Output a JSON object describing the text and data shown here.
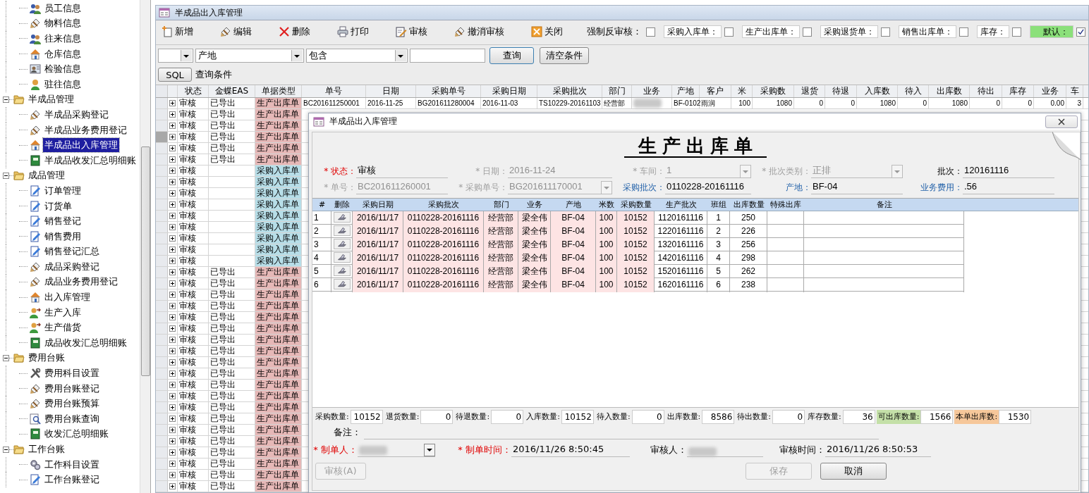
{
  "sidebar": {
    "tree": [
      {
        "children": [
          {
            "label": "员工信息",
            "kind": "people",
            "selected": false
          },
          {
            "label": "物料信息",
            "kind": "pen",
            "selected": false
          },
          {
            "label": "往来信息",
            "kind": "people",
            "selected": false
          },
          {
            "label": "仓库信息",
            "kind": "house",
            "selected": false
          },
          {
            "label": "检验信息",
            "kind": "card",
            "selected": false
          },
          {
            "label": "驻往信息",
            "kind": "person",
            "selected": false
          }
        ]
      },
      {
        "label": "半成品管理",
        "expanded": true,
        "children": [
          {
            "label": "半成品采购登记",
            "kind": "pen",
            "selected": false
          },
          {
            "label": "半成品业务费用登记",
            "kind": "pen",
            "selected": false
          },
          {
            "label": "半成品出入库管理",
            "kind": "house",
            "selected": true
          },
          {
            "label": "半成品收发汇总明细账",
            "kind": "book",
            "selected": false
          }
        ]
      },
      {
        "label": "成品管理",
        "expanded": true,
        "children": [
          {
            "label": "订单管理",
            "kind": "doc",
            "selected": false
          },
          {
            "label": "订货单",
            "kind": "doc",
            "selected": false
          },
          {
            "label": "销售登记",
            "kind": "doc",
            "selected": false
          },
          {
            "label": "销售费用",
            "kind": "doc",
            "selected": false
          },
          {
            "label": "销售登记汇总",
            "kind": "doc",
            "selected": false
          },
          {
            "label": "成品采购登记",
            "kind": "pen",
            "selected": false
          },
          {
            "label": "成品业务费用登记",
            "kind": "pen",
            "selected": false
          },
          {
            "label": "出入库管理",
            "kind": "house",
            "selected": false
          },
          {
            "label": "生产入库",
            "kind": "personarrow",
            "selected": false
          },
          {
            "label": "生产借货",
            "kind": "personarrow",
            "selected": false
          },
          {
            "label": "成品收发汇总明细账",
            "kind": "book",
            "selected": false
          }
        ]
      },
      {
        "label": "费用台账",
        "expanded": true,
        "children": [
          {
            "label": "费用科目设置",
            "kind": "tools",
            "selected": false
          },
          {
            "label": "费用台账登记",
            "kind": "pen",
            "selected": false
          },
          {
            "label": "费用台账预算",
            "kind": "pen",
            "selected": false
          },
          {
            "label": "费用台账查询",
            "kind": "searchdoc",
            "selected": false
          },
          {
            "label": "收发汇总明细账",
            "kind": "book",
            "selected": false
          }
        ]
      },
      {
        "label": "工作台账",
        "expanded": true,
        "children": [
          {
            "label": "工作科目设置",
            "kind": "gears",
            "selected": false
          },
          {
            "label": "工作台账登记",
            "kind": "doc",
            "selected": false
          }
        ]
      }
    ]
  },
  "window": {
    "title": "半成品出入库管理"
  },
  "toolbar": {
    "buttons": [
      {
        "label": "新增",
        "kind": "new"
      },
      {
        "label": "编辑",
        "kind": "pen"
      },
      {
        "label": "删除",
        "kind": "delete"
      },
      {
        "label": "打印",
        "kind": "print"
      },
      {
        "label": "审核",
        "kind": "approve"
      },
      {
        "label": "撤消审核",
        "kind": "pen"
      },
      {
        "label": "关闭",
        "kind": "close"
      }
    ],
    "force_unapprove": {
      "label": "强制反审核：",
      "checked": false
    },
    "filters": [
      {
        "label": "采购入库单：",
        "checked": false,
        "highlighted": false
      },
      {
        "label": "生产出库单：",
        "checked": false,
        "highlighted": false
      },
      {
        "label": "采购退货单：",
        "checked": false,
        "highlighted": false
      },
      {
        "label": "销售出库单：",
        "checked": false,
        "highlighted": false
      },
      {
        "label": "库存：",
        "checked": false,
        "highlighted": false
      },
      {
        "label": "默认：",
        "checked": true,
        "highlighted": true
      }
    ]
  },
  "query": {
    "field": "产地",
    "operator": "包含",
    "search_button": "查询",
    "clear_button": "清空条件",
    "sql_button": "SQL",
    "condition_label": "查询条件"
  },
  "grid": {
    "columns": [
      "状态",
      "金蝶EAS",
      "单据类型",
      "单号",
      "日期",
      "采购单号",
      "采购日期",
      "采购批次",
      "部门",
      "业务",
      "产地",
      "客户",
      "米",
      "采购数",
      "退货",
      "待退",
      "入库数",
      "待入",
      "出库数",
      "待出",
      "库存",
      "业务",
      "车"
    ],
    "rows": [
      {
        "selected": false,
        "color": "#e6b8b7",
        "cells": [
          "审核",
          "已导出",
          "生产出库单",
          "BC201611250001",
          "2016-11-25",
          "BG201611280004",
          "2016-11-03",
          "TS10229-20161103",
          "经营部",
          {
            "redacted": true
          },
          "BF-0102",
          "雨润",
          "100",
          "1080",
          "0",
          "0",
          "1080",
          "0",
          "1080",
          "0",
          "0",
          "0.00",
          "3"
        ]
      },
      {
        "selected": false,
        "color": "#e6b8b7",
        "cells": [
          "审核",
          "已导出",
          "生产出库单"
        ]
      },
      {
        "selected": false,
        "color": "#e6b8b7",
        "cells": [
          "审核",
          "已导出",
          "生产出库单"
        ]
      },
      {
        "selected": true,
        "color": "#e6b8b7",
        "cells": [
          "审核",
          "已导出",
          "生产出库单"
        ]
      },
      {
        "selected": false,
        "color": "#e6b8b7",
        "cells": [
          "审核",
          "已导出",
          "生产出库单"
        ]
      },
      {
        "selected": false,
        "color": "#e6b8b7",
        "cells": [
          "审核",
          "已导出",
          "生产出库单"
        ]
      },
      {
        "selected": false,
        "color": "#b7dee8",
        "cells": [
          "审核",
          null,
          "采购入库单"
        ]
      },
      {
        "selected": false,
        "color": "#b7dee8",
        "cells": [
          "审核",
          null,
          "采购入库单"
        ]
      },
      {
        "selected": false,
        "color": "#b7dee8",
        "cells": [
          "审核",
          null,
          "采购入库单"
        ]
      },
      {
        "selected": false,
        "color": "#b7dee8",
        "cells": [
          "审核",
          null,
          "采购入库单"
        ]
      },
      {
        "selected": false,
        "color": "#b7dee8",
        "cells": [
          "审核",
          null,
          "采购入库单"
        ]
      },
      {
        "selected": false,
        "color": "#b7dee8",
        "cells": [
          "审核",
          null,
          "采购入库单"
        ]
      },
      {
        "selected": false,
        "color": "#b7dee8",
        "cells": [
          "审核",
          null,
          "采购入库单"
        ]
      },
      {
        "selected": false,
        "color": "#b7dee8",
        "cells": [
          "审核",
          null,
          "采购入库单"
        ]
      },
      {
        "selected": false,
        "color": "#b7dee8",
        "cells": [
          "审核",
          null,
          "采购入库单"
        ]
      },
      {
        "selected": false,
        "color": "#e6b8b7",
        "cells": [
          "审核",
          "已导出",
          "生产出库单"
        ]
      },
      {
        "selected": false,
        "color": "#e6b8b7",
        "cells": [
          "审核",
          "已导出",
          "生产出库单"
        ]
      },
      {
        "selected": false,
        "color": "#e6b8b7",
        "cells": [
          "审核",
          "已导出",
          "生产出库单"
        ]
      },
      {
        "selected": false,
        "color": "#e6b8b7",
        "cells": [
          "审核",
          "已导出",
          "生产出库单"
        ]
      },
      {
        "selected": false,
        "color": "#e6b8b7",
        "cells": [
          "审核",
          "已导出",
          "生产出库单"
        ]
      },
      {
        "selected": false,
        "color": "#e6b8b7",
        "cells": [
          "审核",
          "已导出",
          "生产出库单"
        ]
      },
      {
        "selected": false,
        "color": "#e6b8b7",
        "cells": [
          "审核",
          "已导出",
          "生产出库单"
        ]
      },
      {
        "selected": false,
        "color": "#e6b8b7",
        "cells": [
          "审核",
          "已导出",
          "生产出库单"
        ]
      },
      {
        "selected": false,
        "color": "#e6b8b7",
        "cells": [
          "审核",
          "已导出",
          "生产出库单"
        ]
      },
      {
        "selected": false,
        "color": "#e6b8b7",
        "cells": [
          "审核",
          "已导出",
          "生产出库单"
        ]
      },
      {
        "selected": false,
        "color": "#e6b8b7",
        "cells": [
          "审核",
          "已导出",
          "生产出库单"
        ]
      },
      {
        "selected": false,
        "color": "#e6b8b7",
        "cells": [
          "审核",
          "已导出",
          "生产出库单"
        ]
      },
      {
        "selected": false,
        "color": "#e6b8b7",
        "cells": [
          "审核",
          "已导出",
          "生产出库单"
        ]
      },
      {
        "selected": false,
        "color": "#e6b8b7",
        "cells": [
          "审核",
          "已导出",
          "生产出库单"
        ]
      },
      {
        "selected": false,
        "color": "#e6b8b7",
        "cells": [
          "审核",
          "已导出",
          "生产出库单"
        ]
      },
      {
        "selected": false,
        "color": "#e6b8b7",
        "cells": [
          "审核",
          "已导出",
          "生产出库单"
        ]
      },
      {
        "selected": false,
        "color": "#e6b8b7",
        "cells": [
          "审核",
          "已导出",
          "生产出库单"
        ]
      },
      {
        "selected": false,
        "color": "#e6b8b7",
        "cells": [
          "审核",
          "已导出",
          "生产出库单"
        ]
      },
      {
        "selected": false,
        "color": "#e6b8b7",
        "cells": [
          "审核",
          "已导出",
          "生产出库单"
        ]
      },
      {
        "selected": false,
        "color": "#e6b8b7",
        "cells": [
          "审核",
          "已导出",
          "生产出库单"
        ]
      }
    ]
  },
  "dialog": {
    "title": "半成品出入库管理",
    "heading": "生产出库单",
    "fields": [
      {
        "label": "* 状态：",
        "value": "审核",
        "alert": true,
        "linked": false,
        "kind": "text",
        "disabled": false
      },
      {
        "label": "* 日期：",
        "value": "2016-11-24",
        "alert": false,
        "linked": false,
        "kind": "text",
        "disabled": true
      },
      {
        "label": "* 车间：",
        "value": "1",
        "alert": false,
        "linked": false,
        "kind": "dropdown",
        "disabled": true
      },
      {
        "label": "* 批次类别：",
        "value": "正排",
        "alert": false,
        "linked": false,
        "kind": "dropdown",
        "disabled": true
      },
      {
        "label": "批次：",
        "value": "120161116",
        "alert": false,
        "linked": false,
        "kind": "text",
        "disabled": false
      },
      {
        "label": "* 单号：",
        "value": "BC201611260001",
        "alert": false,
        "linked": false,
        "kind": "text",
        "disabled": true
      },
      {
        "label": "* 采购单号：",
        "value": "BG201611170001",
        "alert": false,
        "linked": false,
        "kind": "dropdown",
        "disabled": true
      },
      {
        "label": "采购批次：",
        "value": "0110228-20161116",
        "alert": false,
        "linked": true,
        "kind": "text",
        "disabled": false
      },
      {
        "label": "产地：",
        "value": "BF-04",
        "alert": false,
        "linked": true,
        "kind": "text",
        "disabled": false
      },
      {
        "label": "业务费用：",
        "value": ".56",
        "alert": false,
        "linked": true,
        "kind": "text",
        "disabled": false
      }
    ],
    "table": {
      "columns": [
        {
          "label": "#",
          "locked": false
        },
        {
          "label": "删除",
          "locked": false
        },
        {
          "label": "采购日期",
          "locked": true
        },
        {
          "label": "采购批次",
          "locked": true
        },
        {
          "label": "部门",
          "locked": true
        },
        {
          "label": "业务",
          "locked": true
        },
        {
          "label": "产地",
          "locked": true
        },
        {
          "label": "米数",
          "locked": true
        },
        {
          "label": "采购数量",
          "locked": true
        },
        {
          "label": "生产批次",
          "locked": false
        },
        {
          "label": "班组",
          "locked": false
        },
        {
          "label": "出库数量",
          "locked": false
        },
        {
          "label": "特殊出库",
          "locked": false
        },
        {
          "label": "备注",
          "locked": false
        }
      ],
      "rows": [
        [
          "1",
          null,
          "2016/11/17",
          "0110228-20161116",
          "经营部",
          "梁全伟",
          "BF-04",
          "100",
          "10152",
          "1120161116",
          "1",
          "250",
          null,
          null
        ],
        [
          "2",
          null,
          "2016/11/17",
          "0110228-20161116",
          "经营部",
          "梁全伟",
          "BF-04",
          "100",
          "10152",
          "1220161116",
          "2",
          "226",
          null,
          null
        ],
        [
          "3",
          null,
          "2016/11/17",
          "0110228-20161116",
          "经营部",
          "梁全伟",
          "BF-04",
          "100",
          "10152",
          "1320161116",
          "3",
          "256",
          null,
          null
        ],
        [
          "4",
          null,
          "2016/11/17",
          "0110228-20161116",
          "经营部",
          "梁全伟",
          "BF-04",
          "100",
          "10152",
          "1420161116",
          "4",
          "298",
          null,
          null
        ],
        [
          "5",
          null,
          "2016/11/17",
          "0110228-20161116",
          "经营部",
          "梁全伟",
          "BF-04",
          "100",
          "10152",
          "1520161116",
          "5",
          "262",
          null,
          null
        ],
        [
          "6",
          null,
          "2016/11/17",
          "0110228-20161116",
          "经营部",
          "梁全伟",
          "BF-04",
          "100",
          "10152",
          "1620161116",
          "6",
          "238",
          null,
          null
        ]
      ]
    },
    "totals": [
      {
        "label": "采购数量:",
        "value": "10152"
      },
      {
        "label": "退货数量:",
        "value": "0"
      },
      {
        "label": "待退数量:",
        "value": "0"
      },
      {
        "label": "入库数量:",
        "value": "10152"
      },
      {
        "label": "待入数量:",
        "value": "0"
      },
      {
        "label": "出库数量:",
        "value": "8586"
      },
      {
        "label": "待出数量:",
        "value": "0"
      },
      {
        "label": "库存数量:",
        "value": "36"
      },
      {
        "label": "可出库数量:",
        "value": "1566",
        "color": "#c4e0a8"
      },
      {
        "label": "本单出库数:",
        "value": "1530",
        "color": "#f6c79a"
      }
    ],
    "remark_label": "备注：",
    "signatures": [
      {
        "label": "* 制单人：",
        "alert": true,
        "kind": "dropdown",
        "redacted": true
      },
      {
        "label": "* 制单时间：",
        "alert": true,
        "kind": "text",
        "value": "2016/11/26 8:50:45"
      },
      {
        "label": "审核人：",
        "alert": false,
        "kind": "text",
        "redacted": true
      },
      {
        "label": "审核时间：",
        "alert": false,
        "kind": "text",
        "value": "2016/11/26 8:50:53"
      }
    ],
    "approve_button": {
      "label": "审核(A)",
      "disabled": true
    },
    "buttons": [
      {
        "label": "保存",
        "disabled": true
      },
      {
        "label": "取消",
        "disabled": false
      }
    ]
  }
}
